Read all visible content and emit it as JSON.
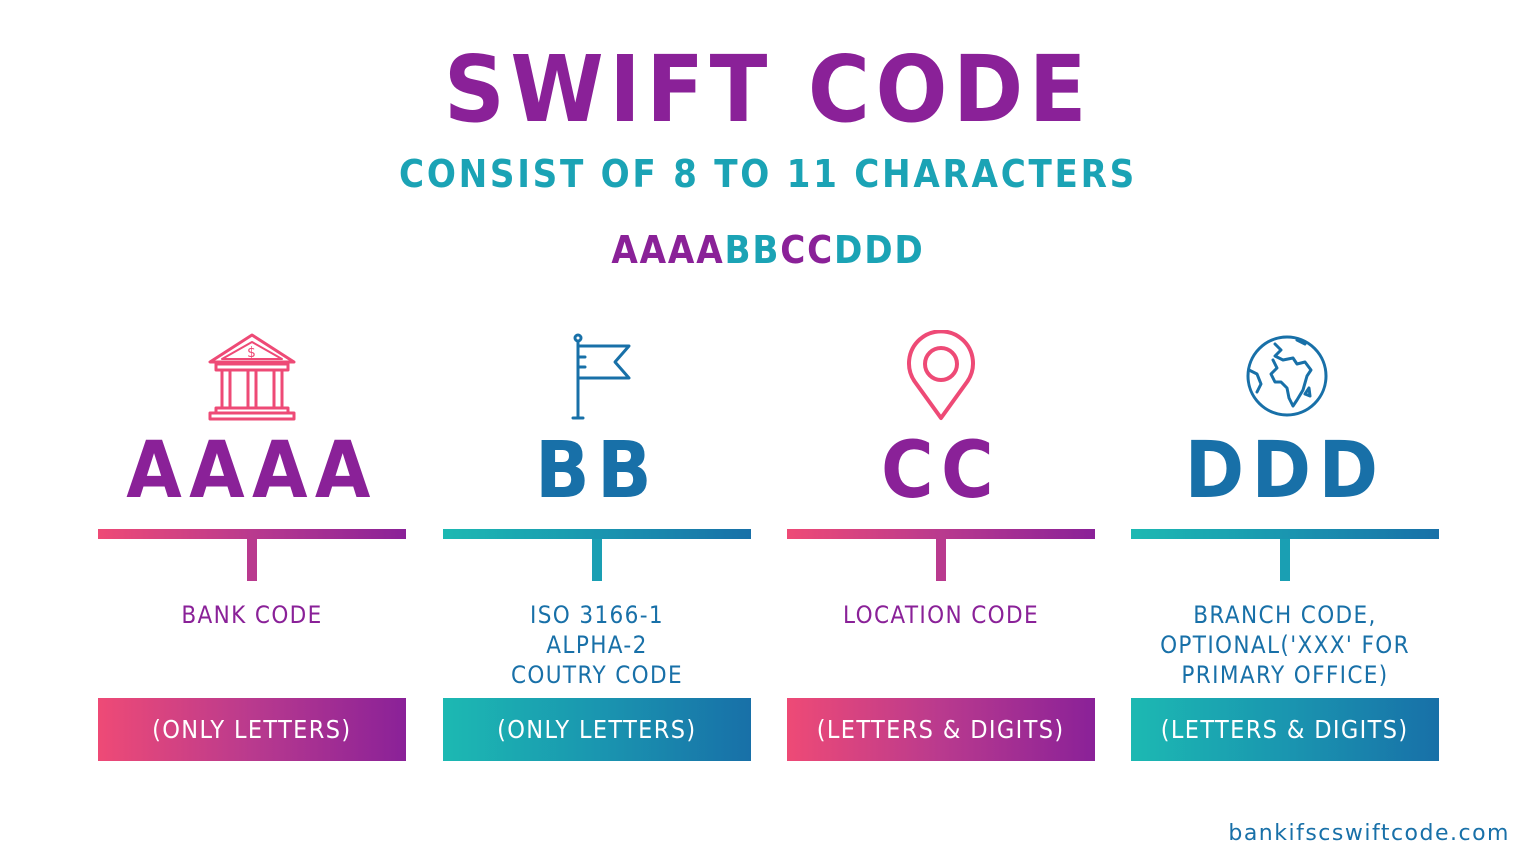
{
  "header": {
    "title": "SWIFT CODE",
    "subtitle": "CONSIST OF 8 TO 11 CHARACTERS",
    "pattern": [
      {
        "text": "AAAA",
        "color": "purple"
      },
      {
        "text": "BB",
        "color": "teal"
      },
      {
        "text": "CC",
        "color": "purple"
      },
      {
        "text": "DDD",
        "color": "teal"
      }
    ]
  },
  "sections": [
    {
      "icon": "bank-icon",
      "code": "AAAA",
      "label": "BANK CODE",
      "chip": "(ONLY LETTERS)"
    },
    {
      "icon": "flag-icon",
      "code": "BB",
      "label": "ISO 3166-1\nALPHA-2\nCOUTRY CODE",
      "label_lines": [
        "ISO 3166-1",
        "ALPHA-2",
        "COUTRY CODE"
      ],
      "chip": "(ONLY LETTERS)"
    },
    {
      "icon": "location-pin-icon",
      "code": "CC",
      "label": "LOCATION CODE",
      "chip": "(LETTERS & DIGITS)"
    },
    {
      "icon": "globe-icon",
      "code": "DDD",
      "label_lines": [
        "BRANCH CODE,",
        "OPTIONAL('XXX' FOR",
        "PRIMARY OFFICE)"
      ],
      "chip": "(LETTERS & DIGITS)"
    }
  ],
  "colors": {
    "purple": "#8a2198",
    "teal": "#1ba3b5",
    "blue": "#1870a8",
    "pink": "#ee4a76"
  },
  "footer": {
    "site": "bankifscswiftcode.com"
  }
}
